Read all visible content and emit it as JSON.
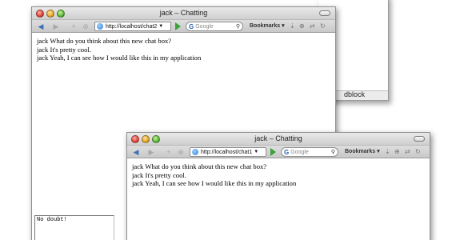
{
  "background_window": {
    "visible_label": "dblock"
  },
  "windows": [
    {
      "title": "jack – Chatting",
      "url": "http://localhost/chat2",
      "search_placeholder": "Google",
      "bookmarks_label": "Bookmarks ▾",
      "messages": [
        {
          "user": "jack",
          "text": "What do you think about this new chat box?"
        },
        {
          "user": "jack",
          "text": "It's pretty cool."
        },
        {
          "user": "jack",
          "text": "Yeah, I can see how I would like this in my application"
        }
      ],
      "input_value": "No doubt!"
    },
    {
      "title": "jack – Chatting",
      "url": "http://localhost/chat1",
      "search_placeholder": "Google",
      "bookmarks_label": "Bookmarks ▾",
      "messages": [
        {
          "user": "jack",
          "text": "What do you think about this new chat box?"
        },
        {
          "user": "jack",
          "text": "It's pretty cool."
        },
        {
          "user": "jack",
          "text": "Yeah, I can see how I would like this in my application"
        }
      ]
    }
  ],
  "colors": {
    "accent": "#3d6fb5",
    "go": "#3aa23a",
    "close": "#e0443a",
    "minimize": "#e6a52b",
    "zoom": "#5cb63a"
  },
  "icons": [
    "back-arrow-icon",
    "forward-arrow-icon",
    "add-icon",
    "stop-icon",
    "globe-icon",
    "go-icon",
    "google-icon",
    "search-icon",
    "download-icon",
    "lock-icon",
    "feed-icon",
    "reload-icon"
  ]
}
